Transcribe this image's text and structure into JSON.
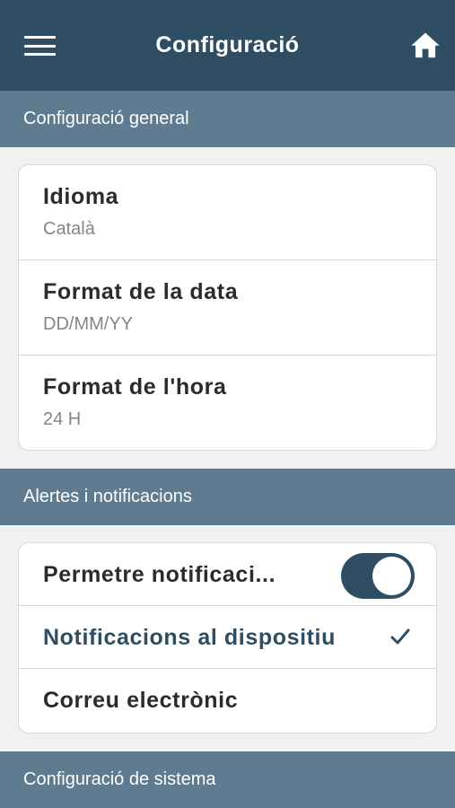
{
  "header": {
    "title": "Configuració",
    "menu_icon": "hamburger-menu-icon",
    "home_icon": "home-icon"
  },
  "sections": {
    "general": {
      "title": "Configuració general",
      "items": [
        {
          "label": "Idioma",
          "value": "Català"
        },
        {
          "label": "Format de la data",
          "value": "DD/MM/YY"
        },
        {
          "label": "Format de l'hora",
          "value": "24 H"
        }
      ]
    },
    "alerts": {
      "title": "Alertes i notificacions",
      "allow_notifications": {
        "label": "Permetre notificaci...",
        "enabled": true
      },
      "device_notifications": {
        "label": "Notificacions al dispositiu",
        "selected": true
      },
      "email": {
        "label": "Correu electrònic",
        "selected": false
      }
    },
    "system": {
      "title": "Configuració de sistema"
    }
  },
  "colors": {
    "primary": "#2f4d63",
    "section_header": "#5f7b8f",
    "background": "#f1f1f1"
  }
}
